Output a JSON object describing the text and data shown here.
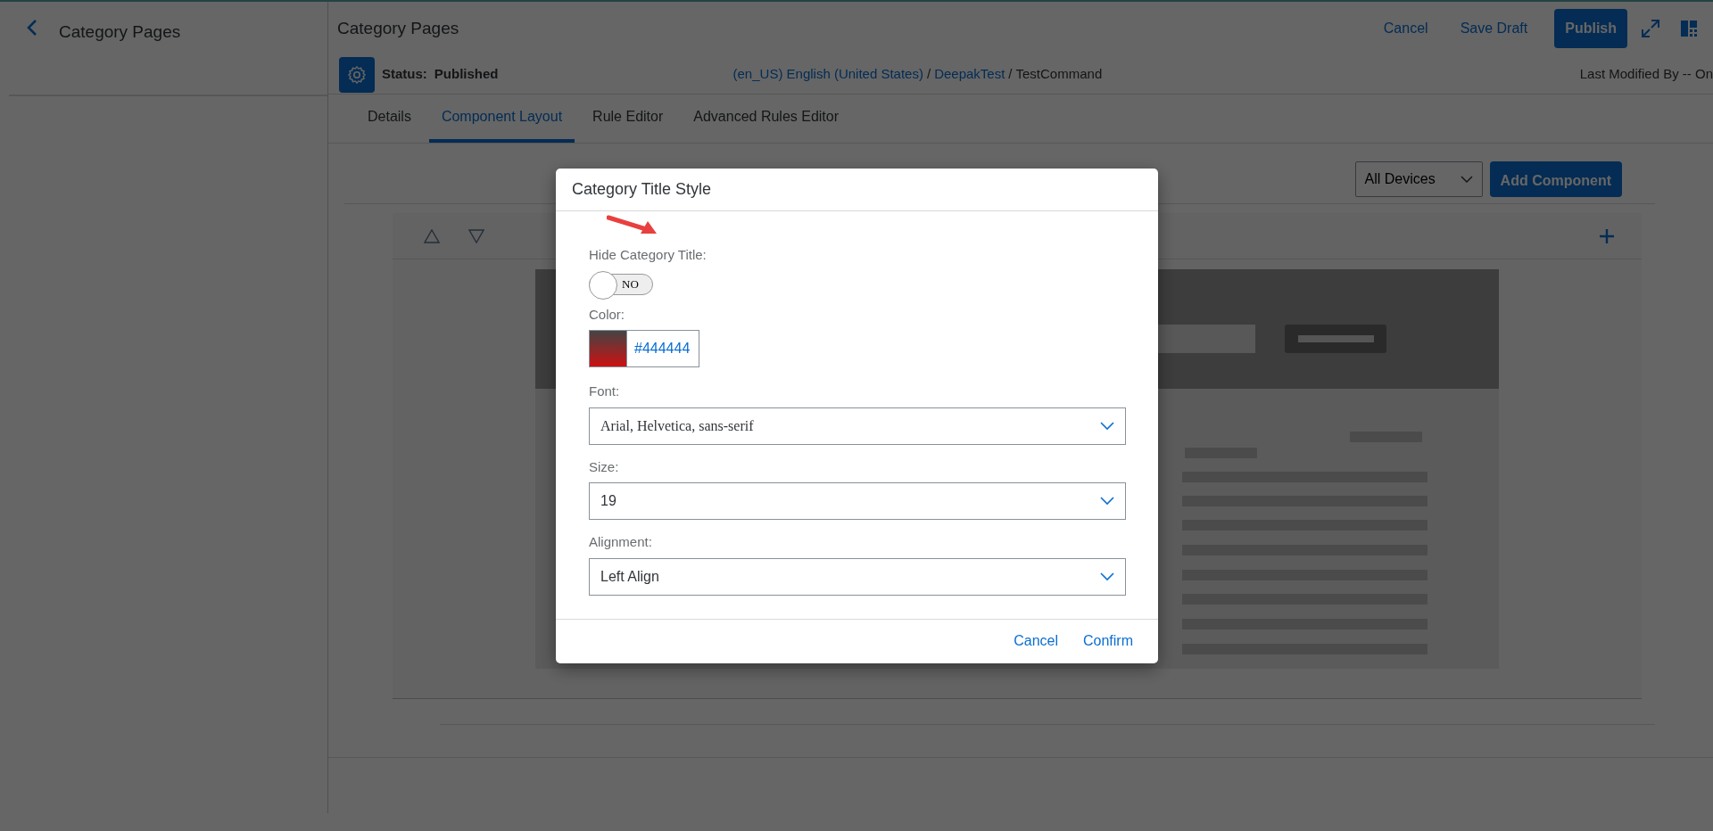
{
  "sidebar": {
    "title": "Category Pages"
  },
  "header": {
    "title": "Category Pages",
    "actions": [
      {
        "label": "Cancel",
        "kind": "link"
      },
      {
        "label": "Save Draft",
        "kind": "link"
      },
      {
        "label": "Publish",
        "kind": "primary"
      }
    ]
  },
  "status": {
    "label": "Status:",
    "value": "Published",
    "separator": "/",
    "breadcrumb": [
      {
        "text": "(en_US) English (United States)",
        "link": true
      },
      {
        "text": "DeepakTest",
        "link": true
      },
      {
        "text": "TestCommand",
        "link": false
      }
    ],
    "last_modified": "Last Modified By -- On"
  },
  "tabs": [
    {
      "label": "Details",
      "selected": false
    },
    {
      "label": "Component Layout",
      "selected": true
    },
    {
      "label": "Rule Editor",
      "selected": false
    },
    {
      "label": "Advanced Rules Editor",
      "selected": false
    }
  ],
  "toolbar": {
    "device_select": "All Devices",
    "add_button": "Add Component"
  },
  "dialog": {
    "title": "Category Title Style",
    "fields": [
      {
        "kind": "toggle",
        "label": "Hide Category Title:",
        "on": false,
        "text": "NO"
      },
      {
        "kind": "color",
        "label": "Color:",
        "value": "#444444"
      },
      {
        "kind": "select",
        "label": "Font:",
        "value": "Arial, Helvetica, sans-serif",
        "serif": true
      },
      {
        "kind": "select",
        "label": "Size:",
        "value": "19",
        "serif": false
      },
      {
        "kind": "select",
        "label": "Alignment:",
        "value": "Left Align",
        "serif": false
      }
    ],
    "buttons": [
      "Cancel",
      "Confirm"
    ]
  }
}
